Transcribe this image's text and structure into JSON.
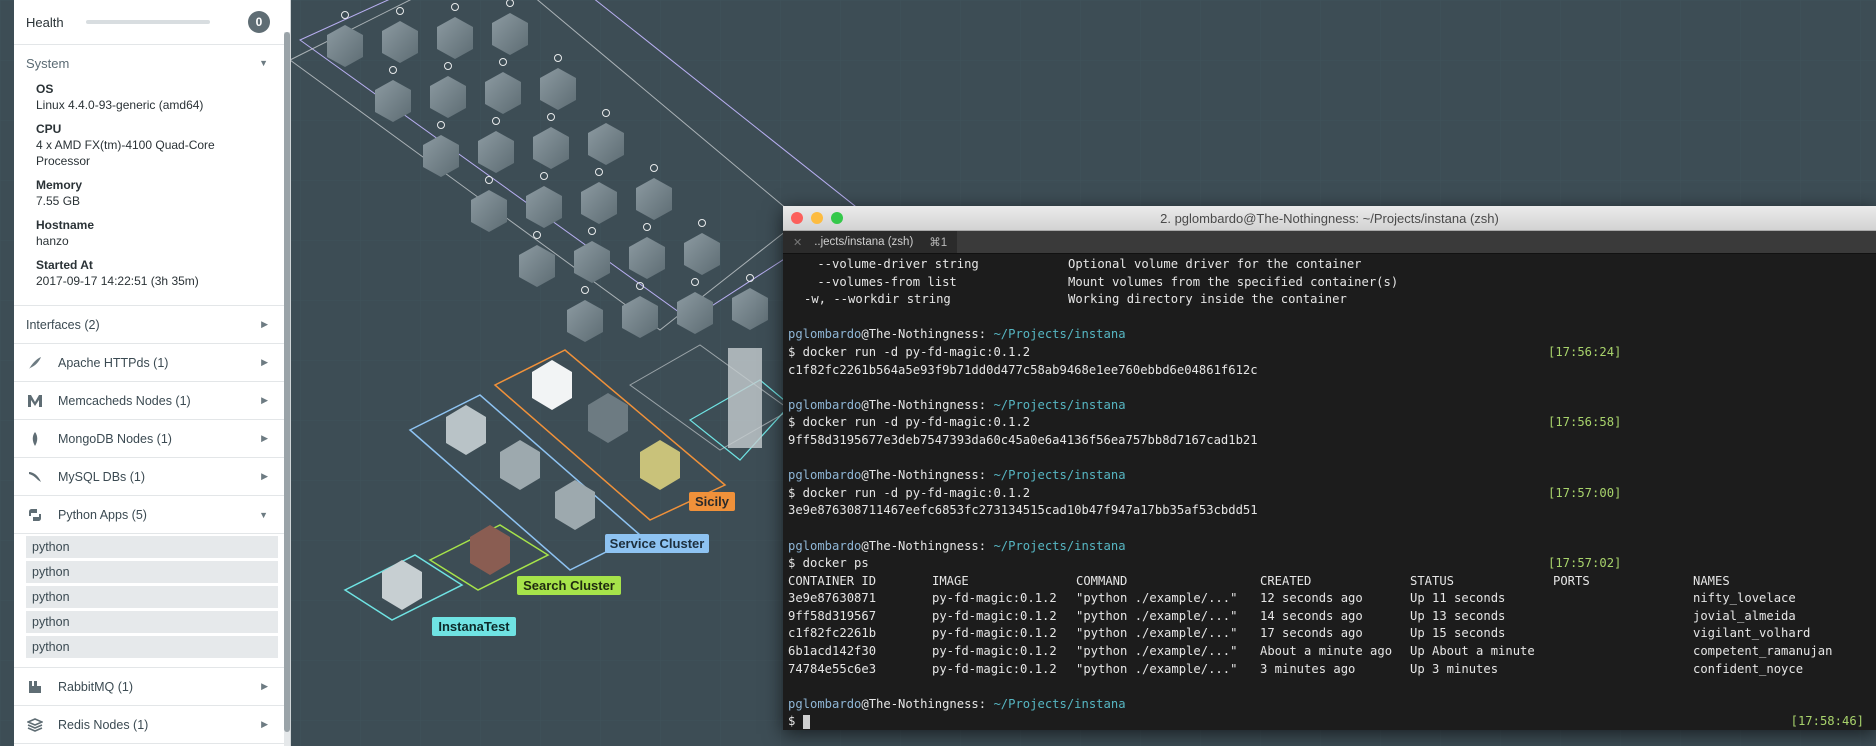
{
  "sidebar": {
    "health": {
      "label": "Health",
      "count": "0"
    },
    "system": {
      "title": "System",
      "fields": [
        {
          "key": "OS",
          "value": "Linux 4.4.0-93-generic (amd64)"
        },
        {
          "key": "CPU",
          "value": "4 x AMD FX(tm)-4100 Quad-Core Processor"
        },
        {
          "key": "Memory",
          "value": "7.55 GB"
        },
        {
          "key": "Hostname",
          "value": "hanzo"
        },
        {
          "key": "Started At",
          "value": "2017-09-17 14:22:51 (3h 35m)"
        }
      ]
    },
    "interfaces": "Interfaces (2)",
    "groups": [
      {
        "label": "Apache HTTPds (1)",
        "icon": "feather-icon"
      },
      {
        "label": "Memcacheds Nodes (1)",
        "icon": "memcached-icon"
      },
      {
        "label": "MongoDB Nodes (1)",
        "icon": "mongodb-leaf-icon"
      },
      {
        "label": "MySQL DBs (1)",
        "icon": "dolphin-icon"
      },
      {
        "label": "Python Apps (5)",
        "icon": "python-icon"
      }
    ],
    "python_apps": [
      "python",
      "python",
      "python",
      "python",
      "python"
    ],
    "groups_after": [
      {
        "label": "RabbitMQ (1)",
        "icon": "rabbitmq-icon"
      },
      {
        "label": "Redis Nodes (1)",
        "icon": "redis-icon"
      }
    ]
  },
  "map": {
    "tags": [
      "Sicily",
      "Service Cluster",
      "Search Cluster",
      "InstanaTest"
    ],
    "colors": {
      "sicily": "#f0913a",
      "service": "#8ec3f2",
      "search": "#a6e34a",
      "instana": "#6fe3e3"
    }
  },
  "terminal": {
    "title": "2. pglombardo@The-Nothingness: ~/Projects/instana (zsh)",
    "tab_label": "..jects/instana (zsh)",
    "tab_shortcut": "⌘1",
    "help_lines": [
      {
        "opt": "    --volume-driver string",
        "desc": "Optional volume driver for the container"
      },
      {
        "opt": "    --volumes-from list",
        "desc": "Mount volumes from the specified container(s)"
      },
      {
        "opt": "-w, --workdir string",
        "desc": "Working directory inside the container"
      }
    ],
    "prompt_user": "pglombardo",
    "prompt_host": "@The-Nothingness:",
    "prompt_path": " ~/Projects/instana",
    "runs": [
      {
        "cmd": "$ docker run -d py-fd-magic:0.1.2",
        "ts": "[17:56:24]",
        "out": "c1f82fc2261b564a5e93f9b71dd0d477c58ab9468e1ee760ebbd6e04861f612c"
      },
      {
        "cmd": "$ docker run -d py-fd-magic:0.1.2",
        "ts": "[17:56:58]",
        "out": "9ff58d3195677e3deb7547393da60c45a0e6a4136f56ea757bb8d7167cad1b21"
      },
      {
        "cmd": "$ docker run -d py-fd-magic:0.1.2",
        "ts": "[17:57:00]",
        "out": "3e9e876308711467eefc6853fc273134515cad10b47f947a17bb35af53cbdd51"
      }
    ],
    "ps_cmd": "$ docker ps",
    "ps_ts": "[17:57:02]",
    "ps_headers": [
      "CONTAINER ID",
      "IMAGE",
      "COMMAND",
      "CREATED",
      "STATUS",
      "PORTS",
      "NAMES"
    ],
    "ps_rows": [
      [
        "3e9e87630871",
        "py-fd-magic:0.1.2",
        "\"python ./example/...\"",
        "12 seconds ago",
        "Up 11 seconds",
        "",
        "nifty_lovelace"
      ],
      [
        "9ff58d319567",
        "py-fd-magic:0.1.2",
        "\"python ./example/...\"",
        "14 seconds ago",
        "Up 13 seconds",
        "",
        "jovial_almeida"
      ],
      [
        "c1f82fc2261b",
        "py-fd-magic:0.1.2",
        "\"python ./example/...\"",
        "17 seconds ago",
        "Up 15 seconds",
        "",
        "vigilant_volhard"
      ],
      [
        "6b1acd142f30",
        "py-fd-magic:0.1.2",
        "\"python ./example/...\"",
        "About a minute ago",
        "Up About a minute",
        "",
        "competent_ramanujan"
      ],
      [
        "74784e55c6e3",
        "py-fd-magic:0.1.2",
        "\"python ./example/...\"",
        "3 minutes ago",
        "Up 3 minutes",
        "",
        "confident_noyce"
      ]
    ],
    "final_prompt": "$ ",
    "final_ts": "[17:58:46]"
  }
}
